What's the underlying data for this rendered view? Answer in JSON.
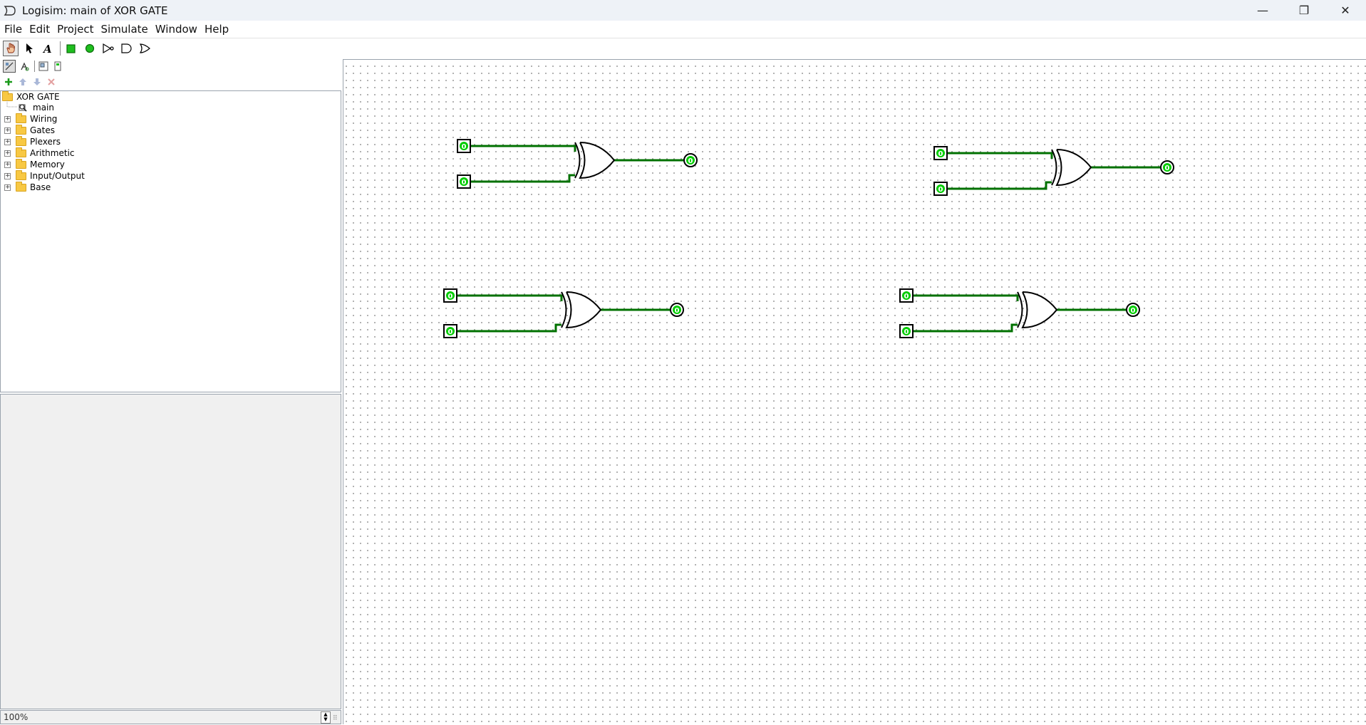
{
  "window": {
    "title": "Logisim: main of XOR GATE",
    "controls": {
      "minimize": "—",
      "maximize": "❐",
      "close": "✕"
    }
  },
  "menu": [
    "File",
    "Edit",
    "Project",
    "Simulate",
    "Window",
    "Help"
  ],
  "toolbar": {
    "tools": [
      {
        "name": "poke-tool",
        "selected": true
      },
      {
        "name": "select-tool",
        "selected": false
      },
      {
        "name": "text-tool",
        "selected": false
      },
      {
        "name": "input-pin-tool",
        "selected": false
      },
      {
        "name": "output-pin-tool",
        "selected": false
      },
      {
        "name": "not-gate-tool",
        "selected": false
      },
      {
        "name": "and-gate-tool",
        "selected": false
      },
      {
        "name": "or-gate-tool",
        "selected": false
      }
    ]
  },
  "explorer": {
    "project": "XOR GATE",
    "items": [
      {
        "label": "main",
        "type": "circuit"
      },
      {
        "label": "Wiring",
        "type": "library"
      },
      {
        "label": "Gates",
        "type": "library"
      },
      {
        "label": "Plexers",
        "type": "library"
      },
      {
        "label": "Arithmetic",
        "type": "library"
      },
      {
        "label": "Memory",
        "type": "library"
      },
      {
        "label": "Input/Output",
        "type": "library"
      },
      {
        "label": "Base",
        "type": "library"
      }
    ]
  },
  "zoom": {
    "value": "100%"
  },
  "circuit": {
    "colors": {
      "wire": "#007100",
      "component": "#000000",
      "pin_value": "#00cc00"
    },
    "xor_gates": [
      {
        "inputs": [
          "0",
          "0"
        ],
        "output": "0"
      },
      {
        "inputs": [
          "0",
          "0"
        ],
        "output": "0"
      },
      {
        "inputs": [
          "0",
          "0"
        ],
        "output": "0"
      },
      {
        "inputs": [
          "0",
          "0"
        ],
        "output": "0"
      }
    ]
  }
}
